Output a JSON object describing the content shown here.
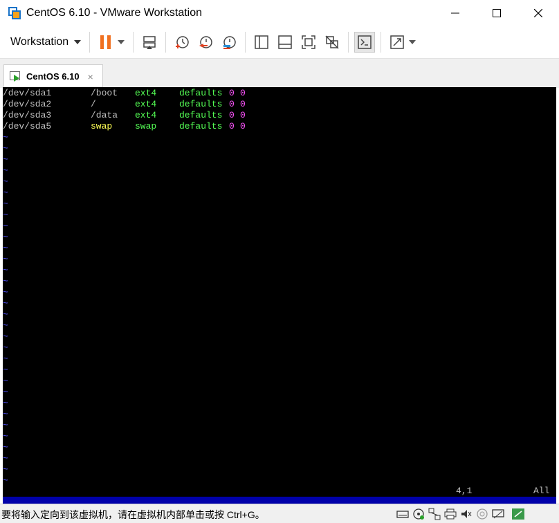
{
  "window": {
    "title": "CentOS 6.10 - VMware Workstation"
  },
  "toolbar": {
    "workstation_label": "Workstation"
  },
  "tab": {
    "label": "CentOS 6.10",
    "close_glyph": "×"
  },
  "terminal": {
    "rows": [
      {
        "dev": "/dev/sda1",
        "mount": "/boot",
        "type": "ext4",
        "options": "defaults",
        "dump": "0",
        "pass": "0",
        "mount_color": "#c0c0c0"
      },
      {
        "dev": "/dev/sda2",
        "mount": "/",
        "type": "ext4",
        "options": "defaults",
        "dump": "0",
        "pass": "0",
        "mount_color": "#c0c0c0"
      },
      {
        "dev": "/dev/sda3",
        "mount": "/data",
        "type": "ext4",
        "options": "defaults",
        "dump": "0",
        "pass": "0",
        "mount_color": "#c0c0c0"
      },
      {
        "dev": "/dev/sda5",
        "mount": "swap",
        "type": "swap",
        "options": "defaults",
        "dump": "0",
        "pass": "0",
        "mount_color": "#ffff55"
      }
    ],
    "tilde": "~",
    "tilde_count": 32,
    "cursor_position": "4,1",
    "scroll_indicator": "All"
  },
  "statusbar": {
    "message": "要将输入定向到该虚拟机，请在虚拟机内部单击或按 Ctrl+G。"
  },
  "colors": {
    "terminal_bg": "#000000",
    "tilde": "#5555ff",
    "type_green": "#55ff55",
    "num_magenta": "#ff55ff",
    "swap_yellow": "#ffff55",
    "vim_bar": "#0000aa",
    "pause_orange": "#f07020"
  },
  "icons": {
    "app": "vmware-app-icon",
    "pause": "pause-icon",
    "send_ctrl_alt_del": "send-keys-icon",
    "snapshot": "snapshot-icon",
    "revert_snapshot": "revert-snapshot-icon",
    "snapshot_manager": "snapshot-manager-icon",
    "console": "console-view-icon",
    "fullscreen": "fullscreen-icon"
  }
}
